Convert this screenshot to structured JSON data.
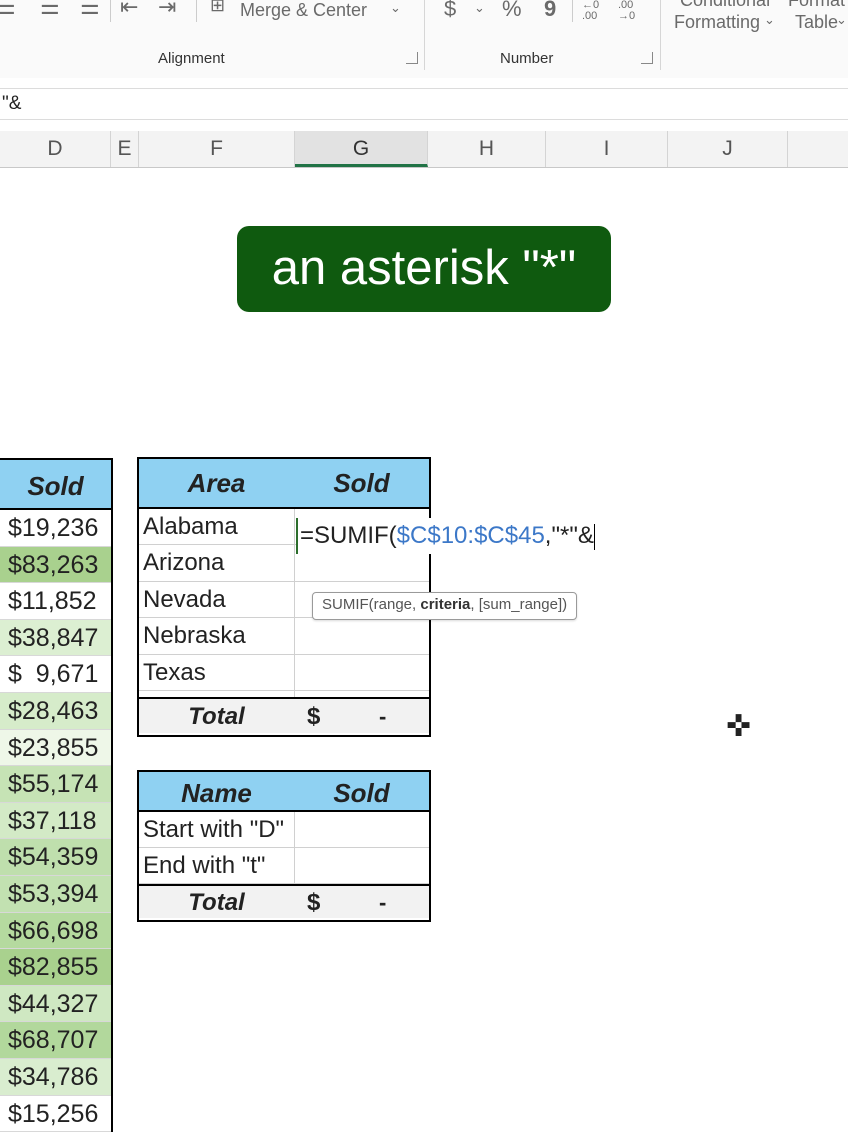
{
  "ribbon": {
    "merge_center": "Merge & Center",
    "alignment_label": "Alignment",
    "number_label": "Number",
    "currency_icon": "$",
    "percent_icon": "%",
    "comma_icon": "9",
    "inc_decimal": "←0 .00",
    "dec_decimal": ".00 →0",
    "conditional_top": "Conditional",
    "conditional_bottom": "Formatting",
    "format_as_top": "Format a",
    "format_as_bottom": "Table"
  },
  "formula_bar": {
    "text": "\"&"
  },
  "columns": [
    "D",
    "E",
    "F",
    "G",
    "H",
    "I",
    "J"
  ],
  "banner": {
    "text": "an asterisk \"*\""
  },
  "left_column": {
    "header": "Sold",
    "values": [
      "$19,236",
      "$83,263",
      "$11,852",
      "$38,847",
      "$  9,671",
      "$28,463",
      "$23,855",
      "$55,174",
      "$37,118",
      "$54,359",
      "$53,394",
      "$66,698",
      "$82,855",
      "$44,327",
      "$68,707",
      "$34,786",
      "$15,256"
    ],
    "fills": [
      "#ffffff",
      "#a9d18e",
      "#ffffff",
      "#dcefd2",
      "#ffffff",
      "#d6ecca",
      "#eef7e8",
      "#c6e3b5",
      "#d3eac6",
      "#bfdfad",
      "#c2e1b1",
      "#b5da9f",
      "#a9d18e",
      "#cfe8c2",
      "#b2d89c",
      "#d9edcf",
      "#ffffff"
    ]
  },
  "area_table": {
    "headers": [
      "Area",
      "Sold"
    ],
    "rows": [
      "Alabama",
      "Arizona",
      "Nevada",
      "Nebraska",
      "Texas"
    ],
    "total_label": "Total",
    "total_currency": "$",
    "total_value": "-"
  },
  "name_table": {
    "headers": [
      "Name",
      "Sold"
    ],
    "rows": [
      "Start with \"D\"",
      "End with \"t\""
    ],
    "total_label": "Total",
    "total_currency": "$",
    "total_value": "-"
  },
  "formula_edit": {
    "prefix": "=SUMIF(",
    "range_ref": "$C$10:$C$45",
    "suffix": ",\"*\"&"
  },
  "tooltip": {
    "func": "SUMIF(range, ",
    "bold_arg": "criteria",
    "rest": ", [sum_range])"
  },
  "colors": {
    "header_blue": "#8fd1f2",
    "banner_green": "#0f5a0f",
    "ref_blue": "#3c78c8",
    "excel_green": "#217346"
  }
}
